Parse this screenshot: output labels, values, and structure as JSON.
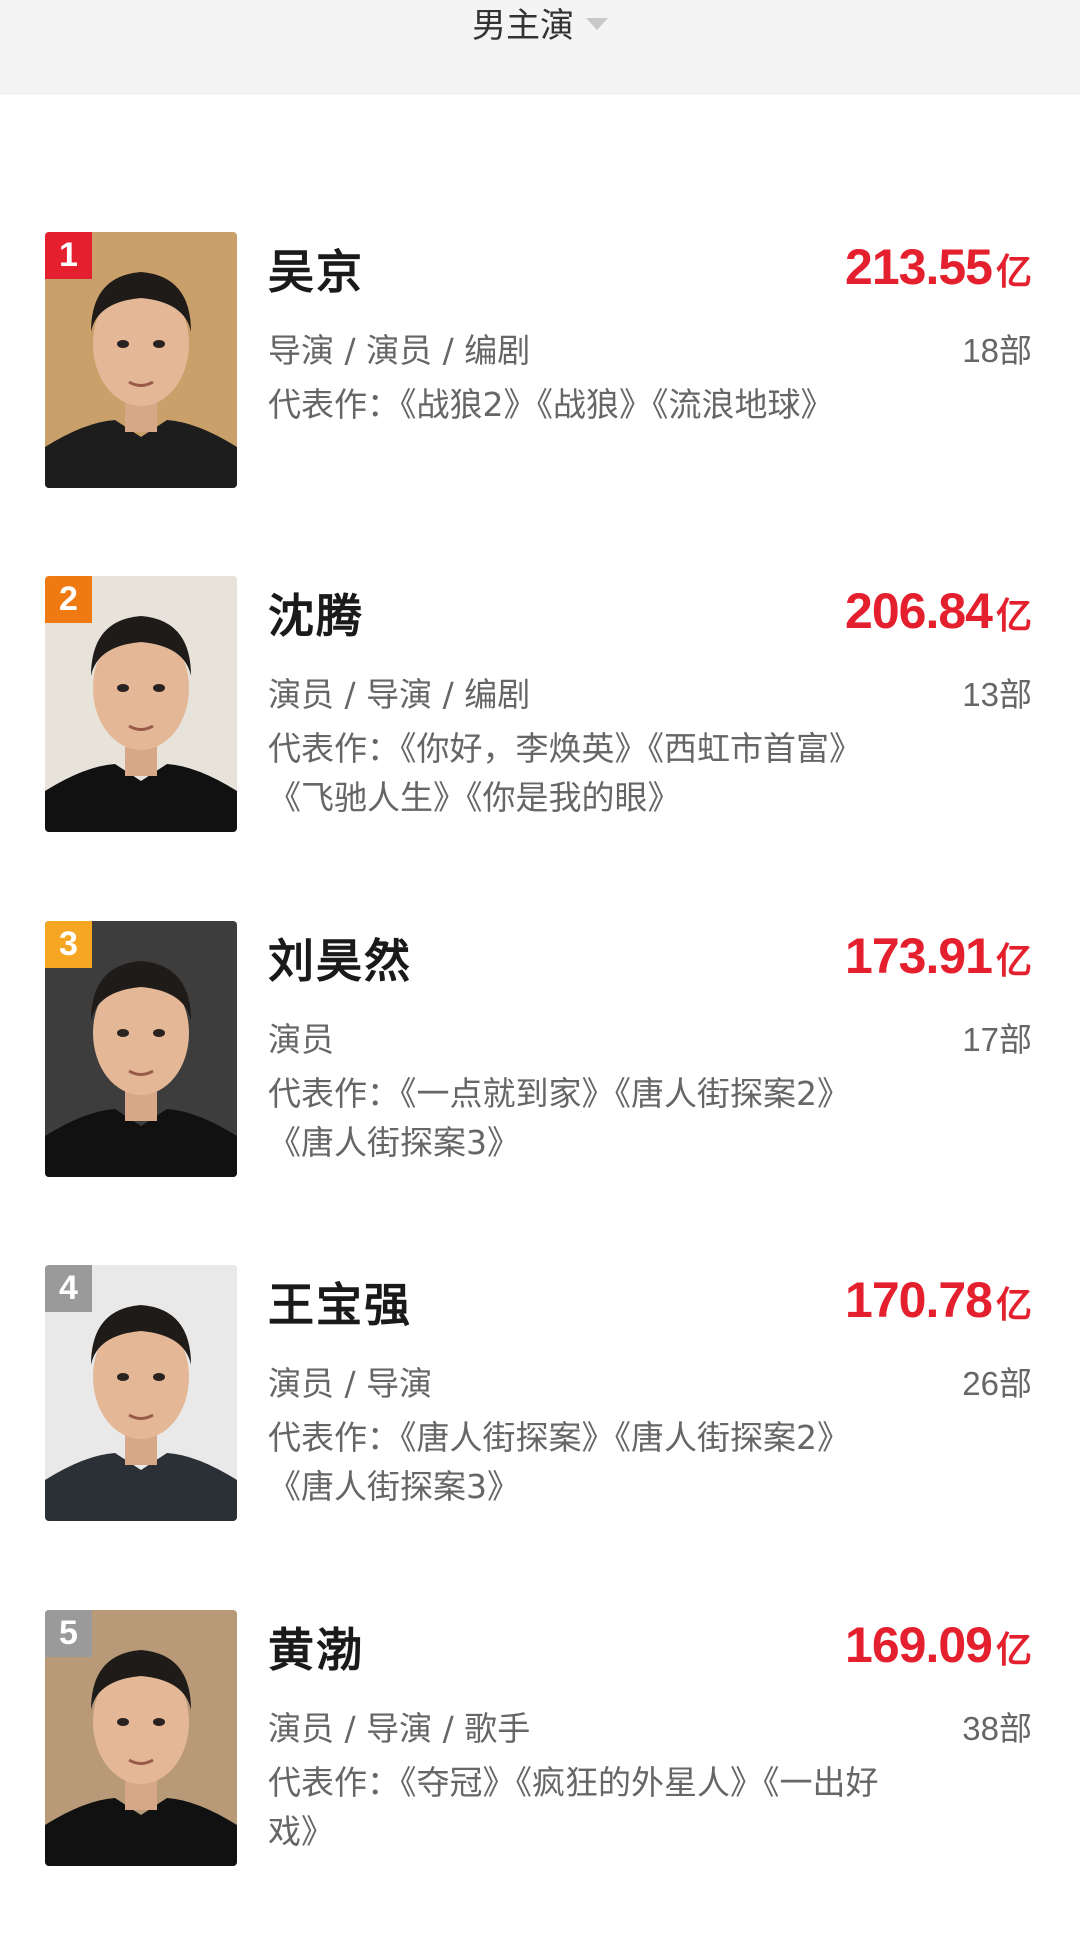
{
  "header": {
    "filter_label": "男主演"
  },
  "actors": [
    {
      "rank": "1",
      "rank_color": "#e5202e",
      "name": "吴京",
      "box_value": "213.55",
      "box_unit": "亿",
      "roles": "导演 / 演员 / 编剧",
      "films": "18部",
      "works": "代表作：《战狼2》《战狼》《流浪地球》",
      "bg": "#c9a06a",
      "shirt": "#1d1d1d"
    },
    {
      "rank": "2",
      "rank_color": "#f07a12",
      "name": "沈腾",
      "box_value": "206.84",
      "box_unit": "亿",
      "roles": "演员 / 导演 / 编剧",
      "films": "13部",
      "works": "代表作：《你好，李焕英》《西虹市首富》《飞驰人生》《你是我的眼》",
      "bg": "#e7e2da",
      "shirt": "#111111"
    },
    {
      "rank": "3",
      "rank_color": "#f5a623",
      "name": "刘昊然",
      "box_value": "173.91",
      "box_unit": "亿",
      "roles": "演员",
      "films": "17部",
      "works": "代表作：《一点就到家》《唐人街探案2》《唐人街探案3》",
      "bg": "#3d3d3d",
      "shirt": "#111111"
    },
    {
      "rank": "4",
      "rank_color": "#9a9a9a",
      "name": "王宝强",
      "box_value": "170.78",
      "box_unit": "亿",
      "roles": "演员 / 导演",
      "films": "26部",
      "works": "代表作：《唐人街探案》《唐人街探案2》《唐人街探案3》",
      "bg": "#e9e9e9",
      "shirt": "#2b2f36"
    },
    {
      "rank": "5",
      "rank_color": "#9a9a9a",
      "name": "黄渤",
      "box_value": "169.09",
      "box_unit": "亿",
      "roles": "演员 / 导演 / 歌手",
      "films": "38部",
      "works": "代表作：《夺冠》《疯狂的外星人》《一出好戏》",
      "bg": "#b89a78",
      "shirt": "#111111"
    }
  ]
}
